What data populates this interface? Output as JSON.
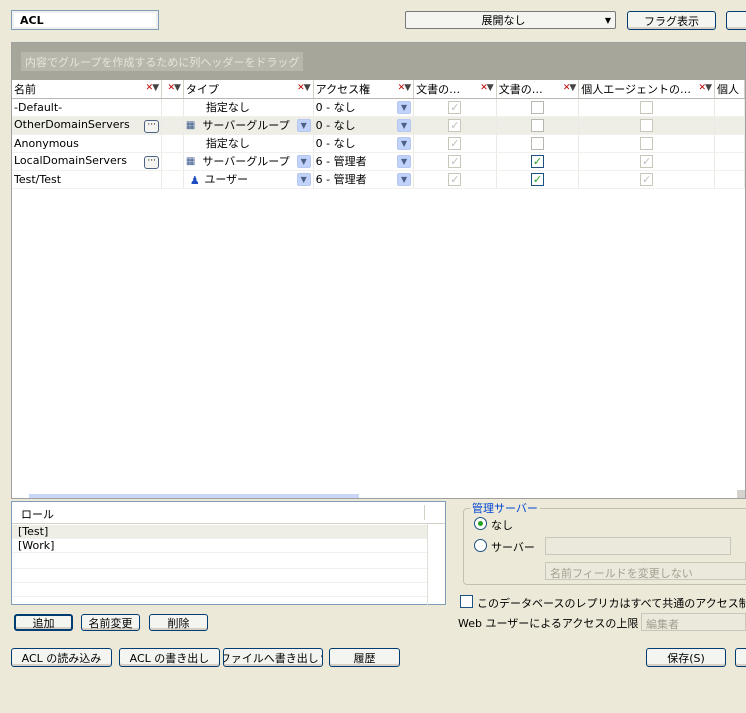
{
  "title": "ACL",
  "toolbar": {
    "expand_dropdown": "展開なし",
    "flag_button": "フラグ表示"
  },
  "grid": {
    "group_hint": "内容でグループを作成するために列ヘッダーをドラッグ",
    "columns": [
      "名前",
      "タイプ",
      "アクセス権",
      "文書の…",
      "文書の…",
      "個人エージェントの…",
      "個人"
    ],
    "rows": [
      {
        "name": "-Default-",
        "type": "指定なし",
        "access": "0 - なし",
        "doc1": "disabled-checked",
        "doc2": "unchecked",
        "agent": "disabled-unchecked",
        "has_ellipsis": false,
        "type_icon": "none"
      },
      {
        "name": "OtherDomainServers",
        "type": "サーバーグループ",
        "access": "0 - なし",
        "doc1": "disabled-checked",
        "doc2": "unchecked",
        "agent": "disabled-unchecked",
        "has_ellipsis": true,
        "type_icon": "server-group-icon"
      },
      {
        "name": "Anonymous",
        "type": "指定なし",
        "access": "0 - なし",
        "doc1": "disabled-checked",
        "doc2": "unchecked",
        "agent": "disabled-unchecked",
        "has_ellipsis": false,
        "type_icon": "none"
      },
      {
        "name": "LocalDomainServers",
        "type": "サーバーグループ",
        "access": "6 - 管理者",
        "doc1": "disabled-checked",
        "doc2": "checked",
        "agent": "disabled-checked",
        "has_ellipsis": true,
        "type_icon": "server-group-icon"
      },
      {
        "name": "Test/Test",
        "type": "ユーザー",
        "access": "6 - 管理者",
        "doc1": "disabled-checked",
        "doc2": "checked",
        "agent": "disabled-checked",
        "has_ellipsis": false,
        "type_icon": "user-icon"
      }
    ]
  },
  "roles": {
    "header": "ロール",
    "items": [
      "[Test]",
      "[Work]"
    ]
  },
  "admin_server": {
    "legend": "管理サーバー",
    "option_none": "なし",
    "option_server": "サーバー",
    "selected": "なし",
    "name_field_option": "名前フィールドを変更しない"
  },
  "replica_checkbox": "このデータベースのレプリカはすべて共通のアクセス制御リス",
  "web_access": {
    "label": "Web ユーザーによるアクセスの上限",
    "value": "編集者"
  },
  "role_buttons": {
    "add": "追加",
    "rename": "名前変更",
    "delete": "削除"
  },
  "bottom_buttons": {
    "read_acl": "ACL の読み込み",
    "write_acl": "ACL の書き出し",
    "export_file": "ファイルへ書き出し",
    "history": "履歴",
    "save": "保存(S)"
  }
}
